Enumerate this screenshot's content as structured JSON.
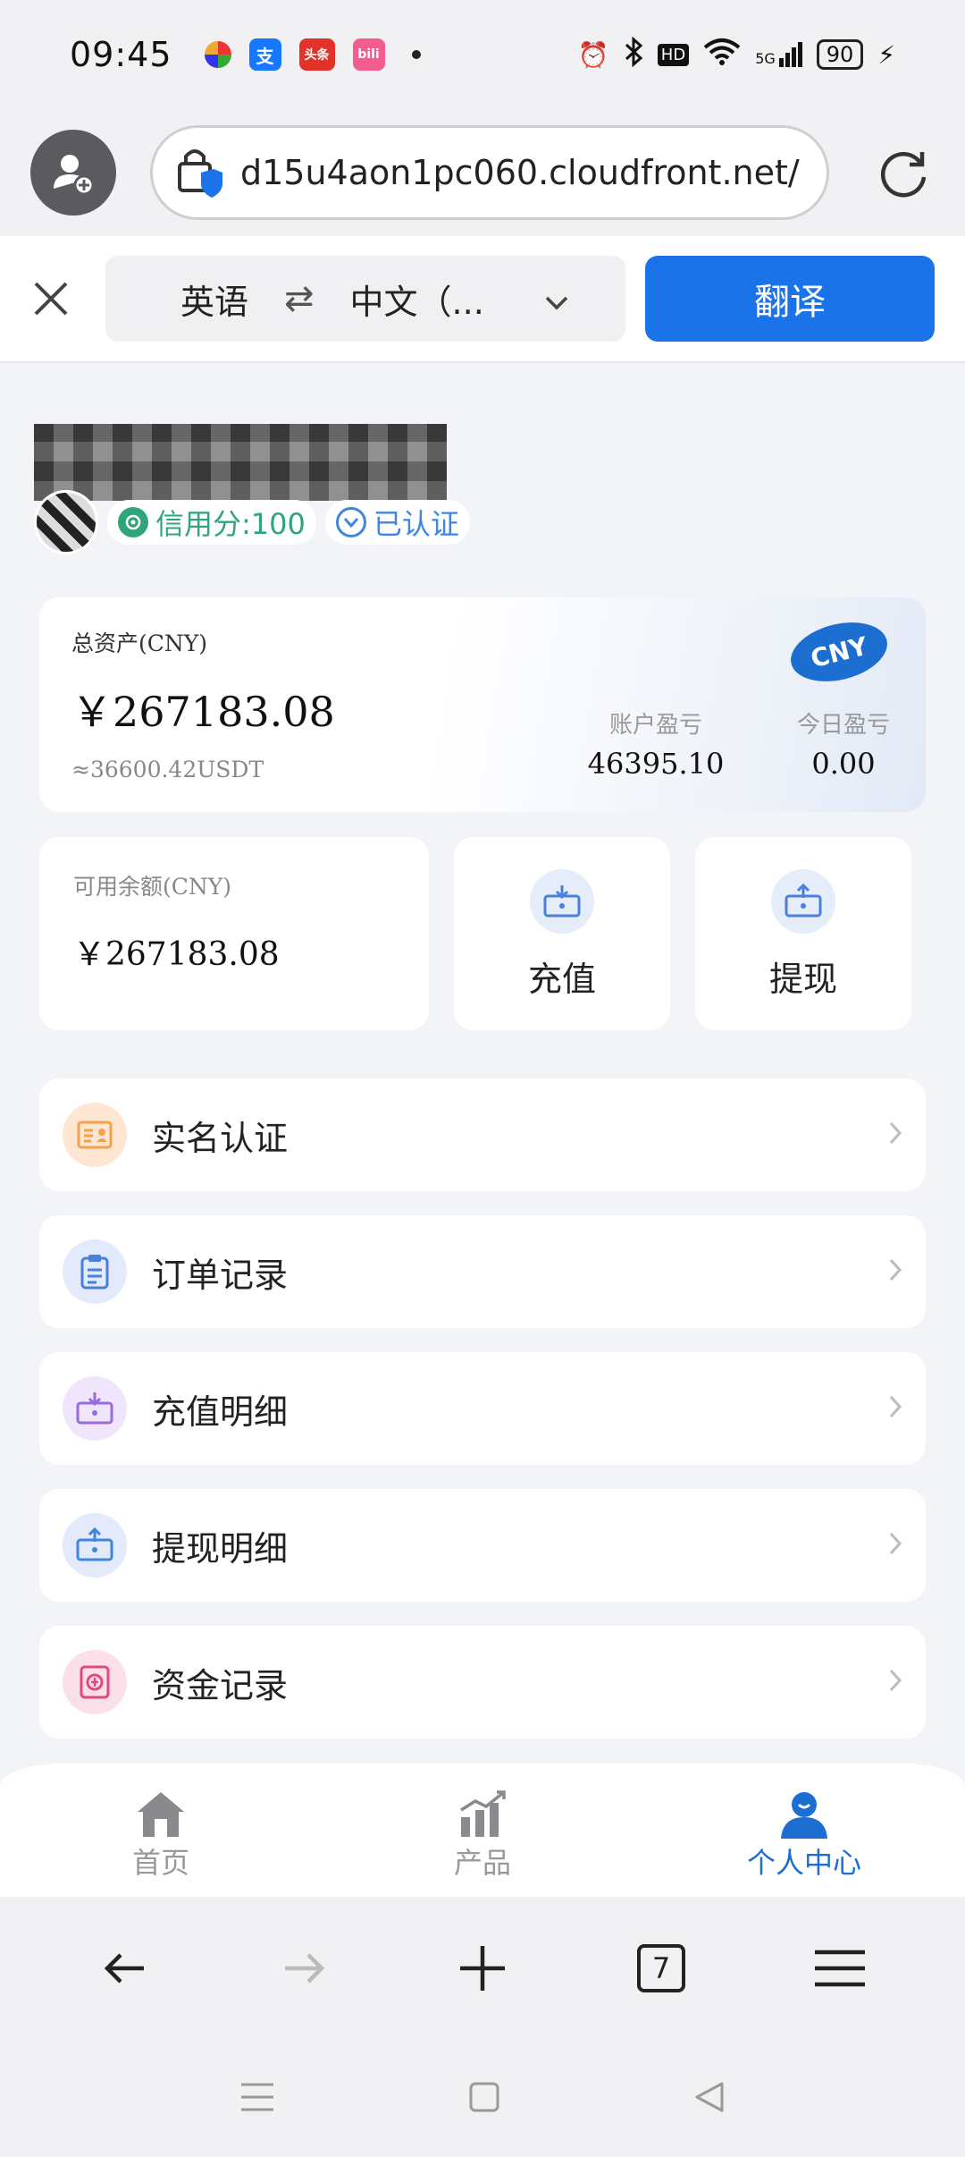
{
  "status": {
    "time": "09:45",
    "battery": "90",
    "network": "5G"
  },
  "browser": {
    "url": "d15u4aon1pc060.cloudfront.net/",
    "tabs_count": "7"
  },
  "translate_bar": {
    "source_lang": "英语",
    "target_lang": "中文（...",
    "translate_button": "翻译"
  },
  "user": {
    "credit_score": "信用分:100",
    "verified": "已认证"
  },
  "assets": {
    "total_label": "总资产(CNY)",
    "total_value": "￥267183.08",
    "usdt_value": "≈36600.42USDT",
    "currency_badge": "CNY",
    "account_pnl_label": "账户盈亏",
    "account_pnl_value": "46395.10",
    "today_pnl_label": "今日盈亏",
    "today_pnl_value": "0.00"
  },
  "balance": {
    "label": "可用余额(CNY)",
    "value": "￥267183.08"
  },
  "actions": {
    "deposit": "充值",
    "withdraw": "提现"
  },
  "menu": [
    {
      "label": "实名认证",
      "icon": "id-card-icon",
      "color": "#f5a04a"
    },
    {
      "label": "订单记录",
      "icon": "clipboard-icon",
      "color": "#4a7fdc"
    },
    {
      "label": "充值明细",
      "icon": "deposit-icon",
      "color": "#9a6ae0"
    },
    {
      "label": "提现明细",
      "icon": "withdraw-icon",
      "color": "#3f86e0"
    },
    {
      "label": "资金记录",
      "icon": "funds-icon",
      "color": "#e04a7a"
    }
  ],
  "tabbar": {
    "home": "首页",
    "products": "产品",
    "profile": "个人中心"
  },
  "colors": {
    "brand_blue": "#1c6fd1",
    "translate_blue": "#1a73e8",
    "credit_green": "#2fa579"
  }
}
